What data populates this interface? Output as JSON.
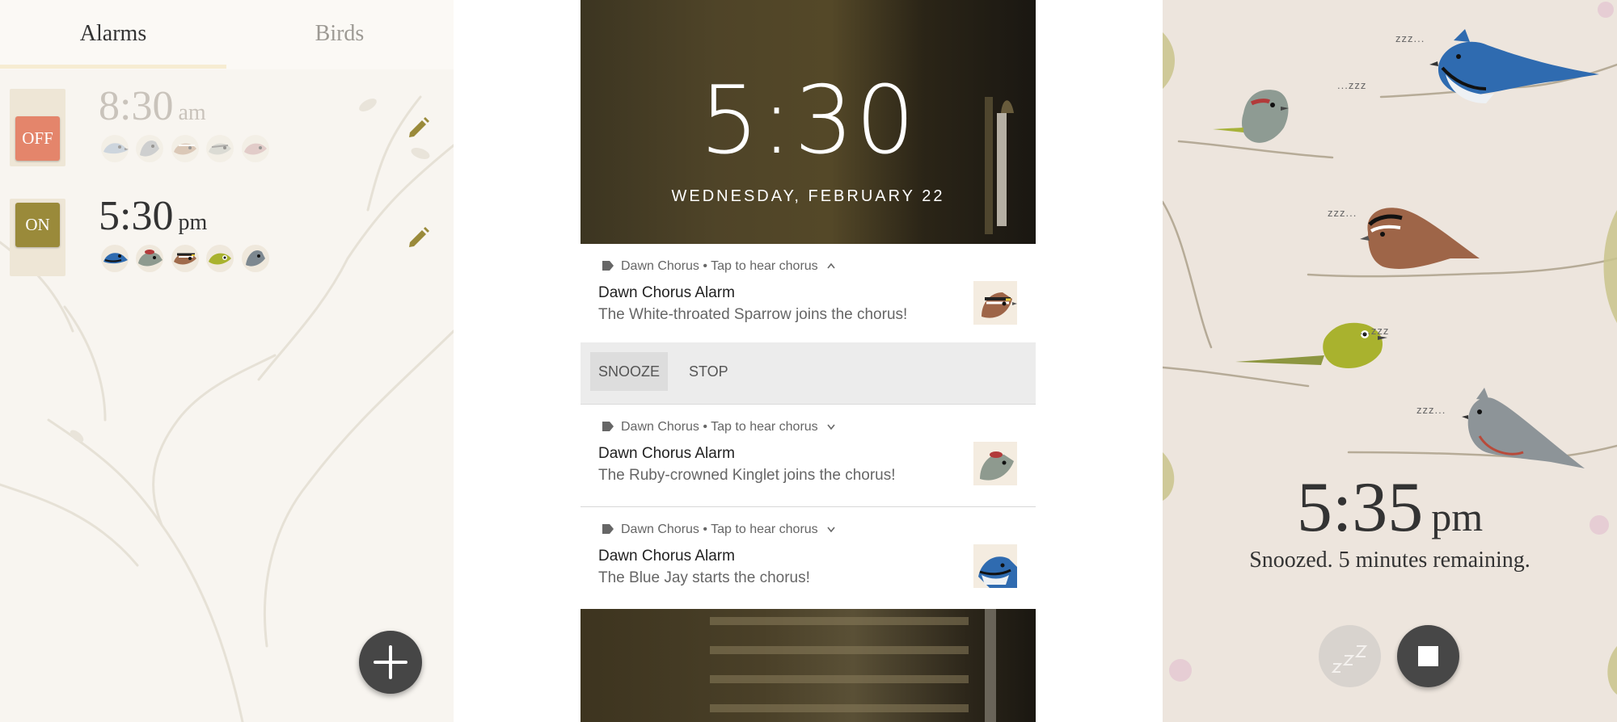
{
  "alarms_screen": {
    "tabs": [
      {
        "label": "Alarms",
        "active": true
      },
      {
        "label": "Birds",
        "active": false
      }
    ],
    "alarms": [
      {
        "time": "8:30",
        "ampm": "am",
        "toggle": "OFF",
        "enabled": false,
        "toggle_color": "#e4856b",
        "birds": [
          "blue-jay",
          "tufted-titmouse",
          "white-throated-sparrow",
          "black-throated-warbler",
          "ruby-crowned-kinglet"
        ]
      },
      {
        "time": "5:30",
        "ampm": "pm",
        "toggle": "ON",
        "enabled": true,
        "toggle_color": "#9a8a3a",
        "birds": [
          "blue-jay",
          "ruby-crowned-kinglet",
          "white-throated-sparrow",
          "warbler-yellow",
          "tufted-titmouse"
        ]
      }
    ],
    "edit_icon": "pencil-icon",
    "fab_icon": "plus-icon",
    "accent_color": "#b3a24a"
  },
  "lock_screen": {
    "time": "5:30",
    "date": "WEDNESDAY, FEBRUARY 22",
    "notifications": [
      {
        "app": "Dawn Chorus",
        "sub": "Tap to hear chorus",
        "expanded": true,
        "title": "Dawn Chorus Alarm",
        "text": "The White-throated Sparrow joins the chorus!",
        "thumb": "white-throated-sparrow"
      },
      {
        "app": "Dawn Chorus",
        "sub": "Tap to hear chorus",
        "expanded": false,
        "title": "Dawn Chorus Alarm",
        "text": "The Ruby-crowned Kinglet joins the chorus!",
        "thumb": "ruby-crowned-kinglet"
      },
      {
        "app": "Dawn Chorus",
        "sub": "Tap to hear chorus",
        "expanded": false,
        "title": "Dawn Chorus Alarm",
        "text": "The Blue Jay starts the chorus!",
        "thumb": "blue-jay"
      }
    ],
    "actions": {
      "snooze": "SNOOZE",
      "stop": "STOP"
    },
    "separator": "•"
  },
  "snooze_screen": {
    "zzz": [
      "zzz...",
      "...zzz",
      "zzz...",
      "...zzz",
      "zzz..."
    ],
    "time": "5:35",
    "ampm": "pm",
    "status": "Snoozed. 5 minutes remaining.",
    "snooze_button_icon": "snooze-zzz-icon",
    "stop_button_icon": "stop-icon"
  }
}
